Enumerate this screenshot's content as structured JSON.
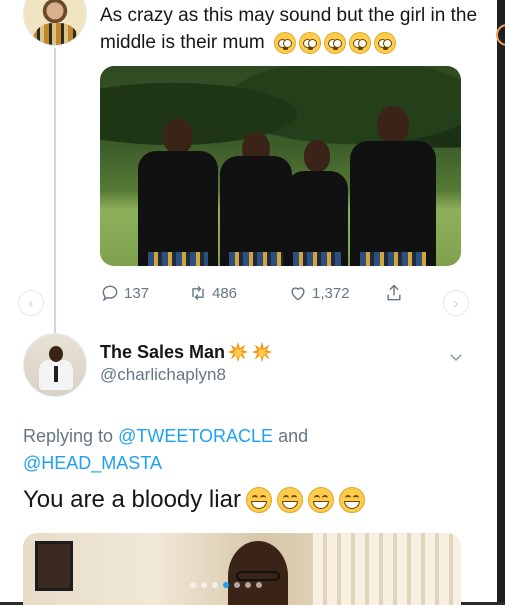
{
  "tweet": {
    "text": "As crazy as this may sound but the girl in the middle is their mum",
    "emoji_count": 5
  },
  "actions": {
    "replies": "137",
    "retweets": "486",
    "likes": "1,372"
  },
  "reply": {
    "display_name": "The Sales Man",
    "handle": "@charlichaplyn8",
    "replying_prefix": "Replying to",
    "mention_1": "@TWEETORACLE",
    "connector": "and",
    "mention_2": "@HEAD_MASTA",
    "text": "You are a bloody liar"
  },
  "carousel": {
    "dots": 7,
    "active_index": 3
  },
  "colors": {
    "text": "#14171a",
    "secondary": "#657786",
    "link": "#1da1f2"
  }
}
